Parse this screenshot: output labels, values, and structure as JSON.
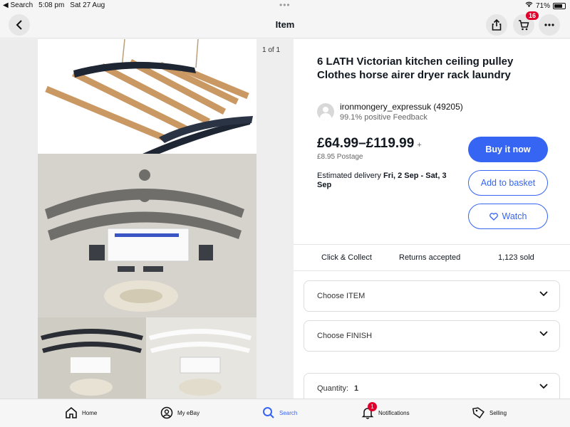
{
  "status": {
    "back_app": "◀ Search",
    "time": "5:08 pm",
    "date": "Sat 27 Aug",
    "battery": "71%"
  },
  "nav": {
    "title": "Item",
    "cart_count": "16"
  },
  "gallery": {
    "counter": "1 of 1"
  },
  "product": {
    "title": "6 LATH Victorian kitchen ceiling pulley Clothes horse airer dryer rack laundry",
    "seller_name": "ironmongery_expressuk (49205)",
    "seller_feedback": "99.1% positive Feedback",
    "price": "£64.99–£119.99",
    "price_plus": "+",
    "postage": "£8.95 Postage",
    "delivery_prefix": "Estimated delivery ",
    "delivery_dates": "Fri, 2 Sep - Sat, 3 Sep"
  },
  "buttons": {
    "buy": "Buy it now",
    "basket": "Add to basket",
    "watch": "Watch"
  },
  "info": {
    "collect": "Click & Collect",
    "returns": "Returns accepted",
    "sold": "1,123 sold"
  },
  "options": {
    "item": "Choose ITEM",
    "finish": "Choose FINISH",
    "quantity_label": "Quantity:",
    "quantity_value": "1"
  },
  "tabs": [
    {
      "label": "Home"
    },
    {
      "label": "My eBay"
    },
    {
      "label": "Search"
    },
    {
      "label": "Notifications",
      "badge": "1"
    },
    {
      "label": "Selling"
    }
  ],
  "colors": {
    "accent": "#3665f3",
    "badge": "#e0002b"
  }
}
